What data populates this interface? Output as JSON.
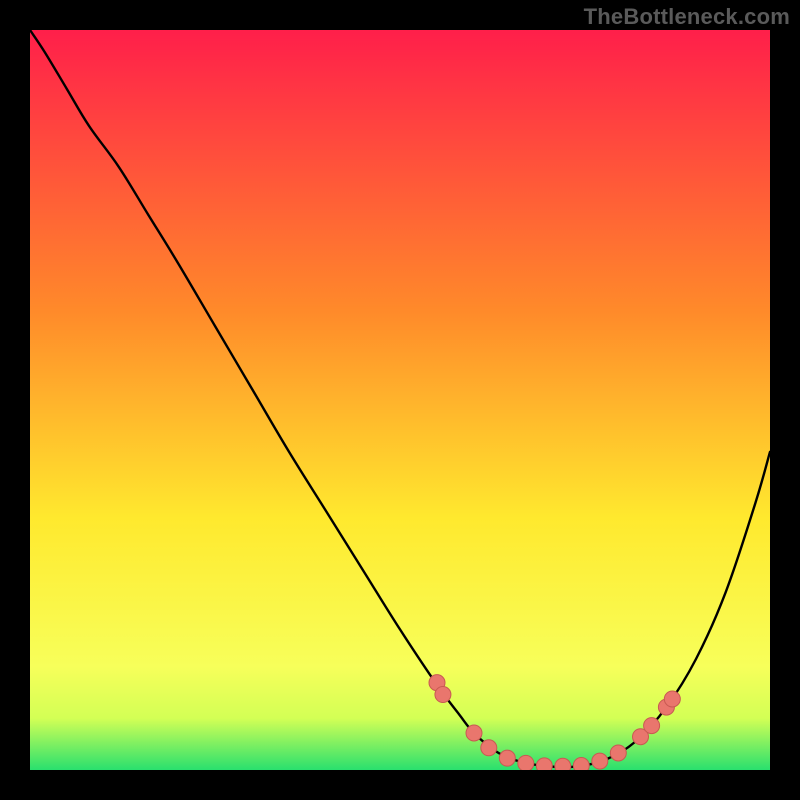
{
  "watermark": "TheBottleneck.com",
  "colors": {
    "grad_top": "#ff1f4a",
    "grad_mid1": "#ff8a2a",
    "grad_mid2": "#ffe92e",
    "grad_low": "#f7ff5a",
    "grad_band": "#d3ff55",
    "grad_bottom": "#29e06e",
    "curve": "#000000",
    "dot_fill": "#e9766d",
    "dot_stroke": "#c85a52",
    "frame": "#000000"
  },
  "chart_data": {
    "type": "line",
    "title": "",
    "xlabel": "",
    "ylabel": "",
    "xlim": [
      0,
      100
    ],
    "ylim": [
      0,
      100
    ],
    "series": [
      {
        "name": "bottleneck-curve",
        "x": [
          0,
          2,
          5,
          8,
          12,
          16,
          20,
          25,
          30,
          35,
          40,
          45,
          50,
          55,
          58,
          60,
          63,
          66,
          70,
          74,
          78,
          82,
          86,
          90,
          94,
          98,
          100
        ],
        "y": [
          100,
          97,
          92,
          87,
          81.5,
          75,
          68.5,
          60,
          51.5,
          43,
          35,
          27,
          19,
          11.5,
          7.5,
          5,
          2.5,
          1.2,
          0.5,
          0.5,
          1.5,
          4,
          8.5,
          15,
          24,
          36,
          43
        ]
      }
    ],
    "scatter": [
      {
        "name": "highlight-dots",
        "points": [
          [
            55,
            11.8
          ],
          [
            55.8,
            10.2
          ],
          [
            60,
            5.0
          ],
          [
            62,
            3.0
          ],
          [
            64.5,
            1.6
          ],
          [
            67,
            0.9
          ],
          [
            69.5,
            0.55
          ],
          [
            72,
            0.5
          ],
          [
            74.5,
            0.6
          ],
          [
            77,
            1.2
          ],
          [
            79.5,
            2.3
          ],
          [
            82.5,
            4.5
          ],
          [
            84,
            6.0
          ],
          [
            86,
            8.5
          ],
          [
            86.8,
            9.6
          ]
        ]
      }
    ]
  }
}
